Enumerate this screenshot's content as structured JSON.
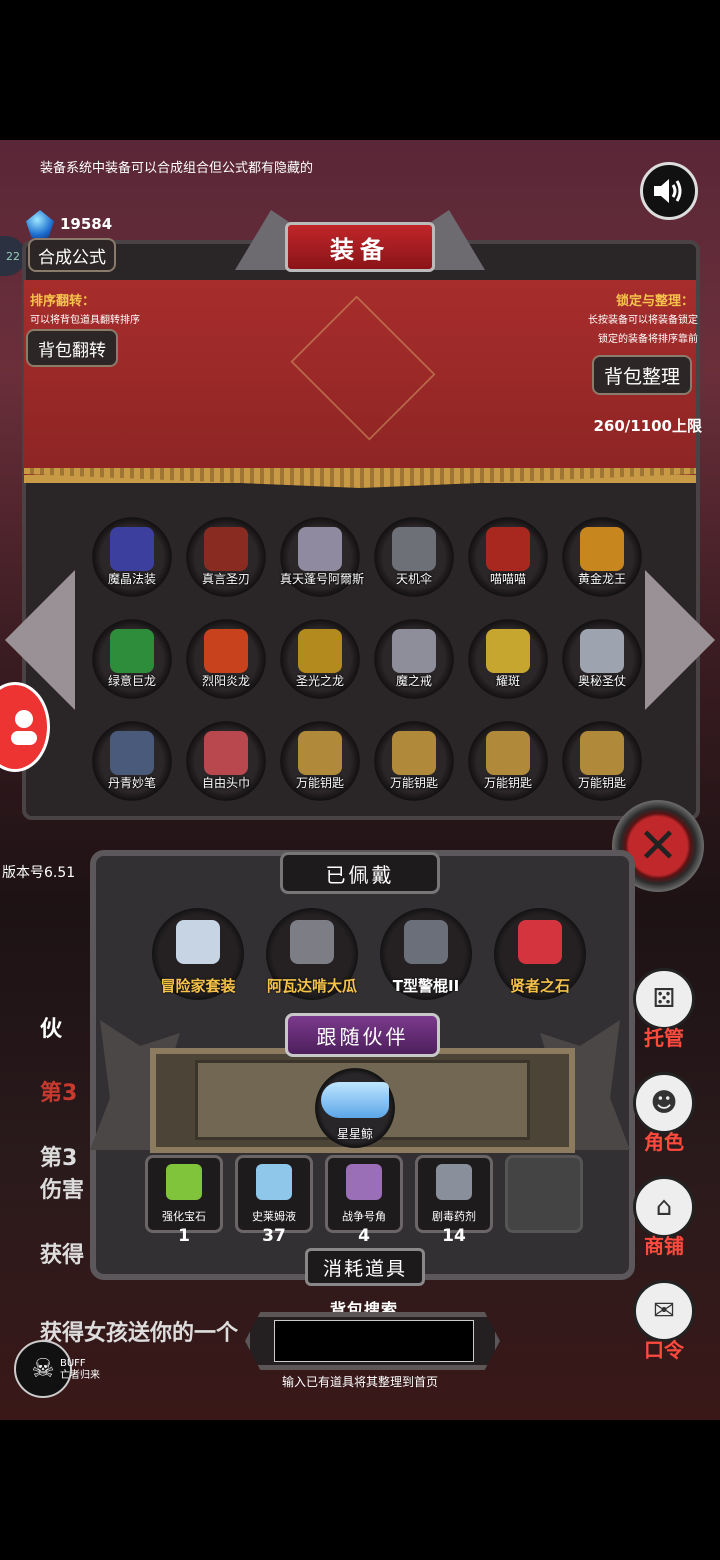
{
  "top_tip": "装备系统中装备可以合成组合但公式都有隐藏的",
  "currency": {
    "amount": "19584"
  },
  "level_badge": "22",
  "title": "装备",
  "buttons": {
    "formula": "合成公式",
    "flip_bag": "背包翻转",
    "organize_bag": "背包整理"
  },
  "sort_info": {
    "title": "排序翻转：",
    "desc": "可以将背包道具翻转排序"
  },
  "lock_info": {
    "title": "锁定与整理：",
    "desc1": "长按装备可以将装备锁定",
    "desc2": "锁定的装备将排序靠前"
  },
  "capacity": "260/1100上限",
  "grid_items": [
    {
      "label": "魔晶法装",
      "icon": "wizard-icon",
      "color": "#3d3f9e"
    },
    {
      "label": "真言圣刃",
      "icon": "blade-icon",
      "color": "#8a2b22"
    },
    {
      "label": "真天蓬号阿爾斯",
      "icon": "warrior-icon",
      "color": "#8f8aa0"
    },
    {
      "label": "天机伞",
      "icon": "axe-icon",
      "color": "#6d7077"
    },
    {
      "label": "喵喵喵",
      "icon": "cat-knight-icon",
      "color": "#a8281f"
    },
    {
      "label": "黄金龙王",
      "icon": "gold-dragon-icon",
      "color": "#c8861e"
    },
    {
      "label": "绿意巨龙",
      "icon": "green-dragon-icon",
      "color": "#2d8d3a"
    },
    {
      "label": "烈阳炎龙",
      "icon": "red-dragon-icon",
      "color": "#c8421e"
    },
    {
      "label": "圣光之龙",
      "icon": "holy-dragon-icon",
      "color": "#b28a1e"
    },
    {
      "label": "魔之戒",
      "icon": "ring-icon",
      "color": "#8e8e9a"
    },
    {
      "label": "耀斑",
      "icon": "flare-icon",
      "color": "#c7a630"
    },
    {
      "label": "奥秘圣仗",
      "icon": "staff-icon",
      "color": "#9ea3b0"
    },
    {
      "label": "丹青妙笔",
      "icon": "brush-icon",
      "color": "#4a5a7a"
    },
    {
      "label": "自由头巾",
      "icon": "headscarf-icon",
      "color": "#b8474e"
    },
    {
      "label": "万能钥匙",
      "icon": "key-icon",
      "color": "#b08a3a"
    },
    {
      "label": "万能钥匙",
      "icon": "key-icon",
      "color": "#b08a3a"
    },
    {
      "label": "万能钥匙",
      "icon": "key-icon",
      "color": "#b08a3a"
    },
    {
      "label": "万能钥匙",
      "icon": "key-icon",
      "color": "#b08a3a"
    }
  ],
  "version": "版本号6.51",
  "equipped": {
    "title": "已佩戴",
    "items": [
      {
        "label": "冒险家套装",
        "icon": "adventurer-icon",
        "color": "#c6d4e4",
        "tint": "gold"
      },
      {
        "label": "阿瓦达啃大瓜",
        "icon": "scepter-icon",
        "color": "#7d7d86",
        "tint": "gold"
      },
      {
        "label": "T型警棍II",
        "icon": "baton-icon",
        "color": "#6a6f7a",
        "tint": "white"
      },
      {
        "label": "贤者之石",
        "icon": "gem-stone-icon",
        "color": "#d4343e",
        "tint": "gold"
      }
    ]
  },
  "companion": {
    "title": "跟随伙伴",
    "pet_label": "星星鲸"
  },
  "consumables": {
    "title": "消耗道具",
    "items": [
      {
        "label": "强化宝石",
        "qty": "1",
        "icon": "green-gem-icon",
        "color": "#7fc43a"
      },
      {
        "label": "史莱姆液",
        "qty": "37",
        "icon": "potion-icon",
        "color": "#8ec7ea"
      },
      {
        "label": "战争号角",
        "qty": "4",
        "icon": "horn-icon",
        "color": "#9a6fb8"
      },
      {
        "label": "剧毒药剂",
        "qty": "14",
        "icon": "poison-icon",
        "color": "#8a8f9c"
      }
    ]
  },
  "search": {
    "title": "背包搜索",
    "hint": "输入已有道具将其整理到首页",
    "value": ""
  },
  "chat_fragments": {
    "a": "伙",
    "b": "第3",
    "c": "第3",
    "d": "伤害",
    "e": "获得",
    "f": "获得女孩送你的一个"
  },
  "side_menu": {
    "auto": "托管",
    "role": "角色",
    "shop": "商铺",
    "code": "口令"
  },
  "buff": {
    "label": "BUFF",
    "name": "亡者归来"
  }
}
